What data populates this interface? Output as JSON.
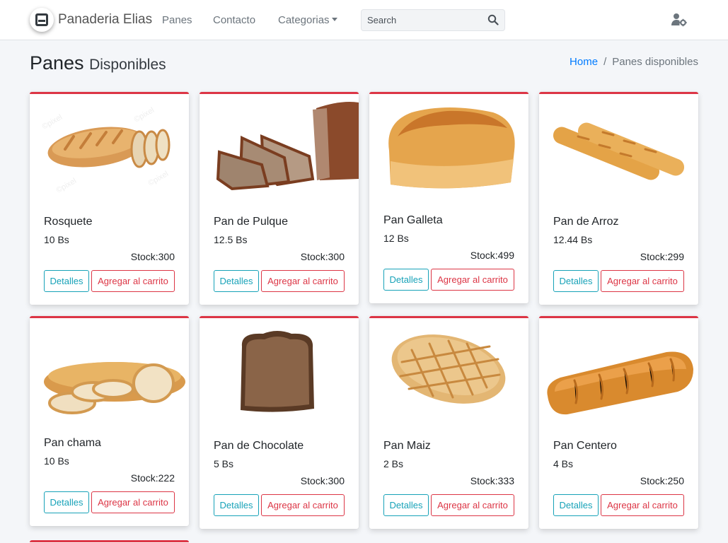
{
  "navbar": {
    "brand": "Panaderia Elias",
    "links": [
      "Panes",
      "Contacto",
      "Categorias"
    ],
    "search_placeholder": "Search"
  },
  "header": {
    "title": "Panes",
    "subtitle": "Disponibles",
    "breadcrumb": [
      "Home",
      "Panes disponibles"
    ]
  },
  "labels": {
    "details": "Detalles",
    "add_to_cart": "Agregar al carrito"
  },
  "products": [
    {
      "name": "Rosquete",
      "price": "10 Bs",
      "stock": "Stock:300",
      "image": "sliced-baguette"
    },
    {
      "name": "Pan de Pulque",
      "price": "12.5 Bs",
      "stock": "Stock:300",
      "image": "sliced-rye-loaf"
    },
    {
      "name": "Pan Galleta",
      "price": "12 Bs",
      "stock": "Stock:499",
      "image": "white-loaf"
    },
    {
      "name": "Pan de Arroz",
      "price": "12.44 Bs",
      "stock": "Stock:299",
      "image": "two-baguettes"
    },
    {
      "name": "Pan chama",
      "price": "10 Bs",
      "stock": "Stock:222",
      "image": "sliced-loaf"
    },
    {
      "name": "Pan de Chocolate",
      "price": "5 Bs",
      "stock": "Stock:300",
      "image": "chocolate-slice"
    },
    {
      "name": "Pan Maiz",
      "price": "2 Bs",
      "stock": "Stock:333",
      "image": "scored-corn-loaf"
    },
    {
      "name": "Pan Centero",
      "price": "4 Bs",
      "stock": "Stock:250",
      "image": "long-golden-loaf"
    }
  ],
  "colors": {
    "accent": "#dc3545",
    "info": "#17a2b8",
    "link": "#007bff",
    "background": "#f4f6f9"
  }
}
